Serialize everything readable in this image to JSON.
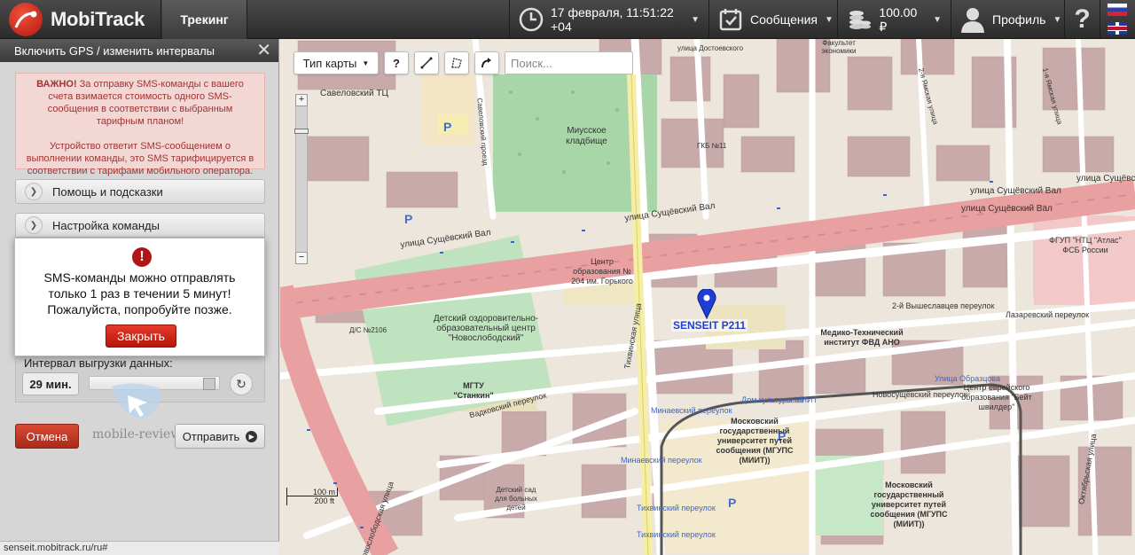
{
  "app": {
    "name": "MobiTrack",
    "active_tab": "Трекинг"
  },
  "topbar": {
    "datetime": "17 февраля, 11:51:22 +04",
    "messages_label": "Сообщения",
    "balance": "100.00 ₽",
    "profile_label": "Профиль",
    "help_label": "?"
  },
  "sidebar": {
    "header": "Включить GPS / изменить интервалы",
    "warning_strong": "ВАЖНО!",
    "warning_text_1": " За отправку SMS-команды с вашего счета взимается стоимость одного SMS-сообщения в соответствии с выбранным тарифным планом!",
    "warning_text_2": "Устройство ответит SMS-сообщением о выполнении команды, это SMS тарифицируется в соответствии с тарифами мобильного оператора.",
    "accordion_help": "Помощь и подсказки",
    "accordion_settings": "Настройка команды",
    "interval_label": "Интервал выгрузки данных:",
    "interval_value": "29 мин.",
    "interval_level": 0.97,
    "cancel_button": "Отмена",
    "send_button": "Отправить",
    "watermark": "mobile-review.com"
  },
  "modal": {
    "icon": "!",
    "line1": "SMS-команды можно отправлять",
    "line2": "только 1 раз в течении 5 минут!",
    "line3": "Пожалуйста, попробуйте позже.",
    "close_button": "Закрыть"
  },
  "map": {
    "toolbar": {
      "map_type": "Тип карты",
      "help": "?",
      "search_placeholder": "Поиск..."
    },
    "zoom_in": "+",
    "zoom_out": "−",
    "marker_label": "SENSEIT P211",
    "scale_m": "100 m",
    "scale_ft": "200 ft",
    "labels": {
      "savelovsky": "Савеловский ТЦ",
      "miusskoe": "Миусское кладбище",
      "sushchevsky_1": "улица Сущёвский Вал",
      "sushchevsky_2": "улица Сущёвский Вал",
      "sushchevsky_3": "улица Сущёвский Вал",
      "sushchevsky_4": "улица Сущёвский Вал",
      "sushchevsky_5": "улица Сущёвский Вал",
      "center204": "Центр образования № 204 им. Горького",
      "detsky": "Детский оздоровительно-образовательный центр \"Новослободский\"",
      "mgtu": "МГТУ \"Станкин\"",
      "vadkovsky": "Вадковский переулок",
      "tikhvinskaya": "Тихвинская улица",
      "vysheslavtsev": "2-й Вышеславцев переулок",
      "lazarevsky": "Лазаревский переулок",
      "medtech": "Медико-Технический институт ФВД АНО",
      "dk_miit": "Дом культуры МИИТ",
      "minaevsky_1": "Минаевский переулок",
      "minaevsky_2": "Минаевский переулок",
      "novosushchevsky": "Новосущёвский переулок",
      "miit_1": "Московский государственный университет путей сообщения (МГУПС (МИИТ))",
      "miit_2": "Московский государственный университет путей сообщения (МГУПС (МИИТ))",
      "fgup": "ФГУП \"НТЦ \"Атлас\" ФСБ России",
      "gkb11": "ГКБ №11",
      "tikhvinsky_per": "Тихвинский переулок",
      "tikhvinsky_per2": "Тихвинский переулок",
      "obraztsova": "Улица Образцова",
      "jewish": "Центр еврейского образования \"Бейт швилдер\"",
      "oktyabrskaya": "Октябрьская улица",
      "novoslobodskaya": "Новослободская улица",
      "dsad": "Детский сад для больных детей",
      "ds2106": "Д/С №2106",
      "yamskaya": "1-я Ямская улица",
      "yamskaya2": "2-я Ямская улица",
      "sav_proezd": "Савеловский проезд",
      "dostoevskogo": "улица Достоевского",
      "fakultet": "Факультет экономики"
    }
  },
  "statusbar": {
    "url": "senseit.mobitrack.ru/ru#"
  },
  "colors": {
    "accent_red": "#c21a0e",
    "marker_blue": "#1f3fd4",
    "warning_bg": "#f2d7d5",
    "warning_text": "#a5332f",
    "road_pink": "#e8a0a0"
  },
  "icons": {
    "logo": "mobitrack-logo",
    "clock": "clock-icon",
    "messages": "calendar-check-icon",
    "balance": "coins-icon",
    "profile": "user-icon"
  }
}
